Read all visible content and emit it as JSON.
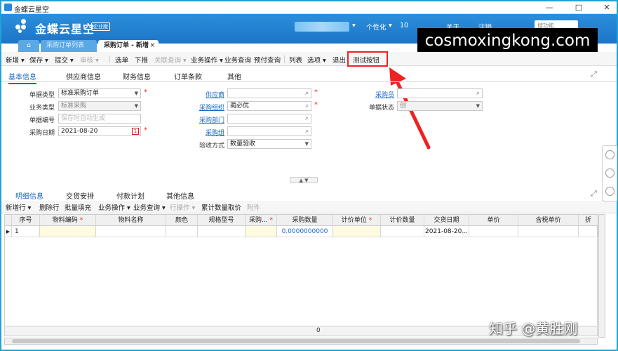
{
  "window": {
    "title": "金蝶云星空",
    "min": "—",
    "max": "□",
    "close": "✕"
  },
  "header": {
    "brand": "金蝶云星空",
    "edition": "企业版",
    "menu_personalize": "个性化",
    "menu_number": "10",
    "menu_about": "关于",
    "menu_logout": "注销",
    "search_placeholder": "搜功能"
  },
  "tabs": {
    "list": "采购订单列表",
    "active": "采购订单 - 新增",
    "close": "×"
  },
  "watermark": "cosmoxingkong.com",
  "toolbar": {
    "items": [
      "新增",
      "保存",
      "提交",
      "审核",
      "选单",
      "下推",
      "关联查询",
      "业务操作",
      "业务查询",
      "预付查询",
      "列表",
      "选项",
      "退出",
      "测试按钮"
    ]
  },
  "section_tabs": [
    "基本信息",
    "供应商信息",
    "财务信息",
    "订单条款",
    "其他"
  ],
  "form": {
    "doc_type_label": "单据类型",
    "doc_type_value": "标准采购订单",
    "biz_type_label": "业务类型",
    "biz_type_value": "标准采购",
    "doc_no_label": "单据编号",
    "doc_no_placeholder": "保存时自动生成",
    "date_label": "采购日期",
    "date_value": "2021-08-20",
    "cal_glyph": "1",
    "supplier_label": "供应商",
    "supplier_value": "",
    "purchase_org_label": "采购组织",
    "purchase_org_value": "蔺必优",
    "purchase_dept_label": "采购部门",
    "purchase_dept_value": "",
    "purchase_group_label": "采购组",
    "purchase_group_value": "",
    "inspect_label": "验收方式",
    "inspect_value": "数量验收",
    "buyer_label": "采购员",
    "buyer_value": "",
    "status_label": "单据状态",
    "status_value": "创"
  },
  "detail_tabs": [
    "明细信息",
    "交货安排",
    "付款计划",
    "其他信息"
  ],
  "detail_toolbar": [
    "新增行",
    "删除行",
    "批量填充",
    "业务操作",
    "业务查询",
    "行操作",
    "累计数量取价",
    "附件"
  ],
  "grid": {
    "headers": [
      "序号",
      "物料编码",
      "物料名称",
      "颜色",
      "规格型号",
      "采购...",
      "采购数量",
      "计价单位",
      "计价数量",
      "交货日期",
      "单价",
      "含税单价",
      "折"
    ],
    "row": {
      "seq": "1",
      "qty": "0.0000000000",
      "date": "2021-08-20..."
    },
    "total": "0"
  },
  "zhihu": "知乎 @黄胜刚",
  "colors": {
    "header": "#1d74c8",
    "accent": "#1a66c2",
    "highlight": "#e22222"
  }
}
